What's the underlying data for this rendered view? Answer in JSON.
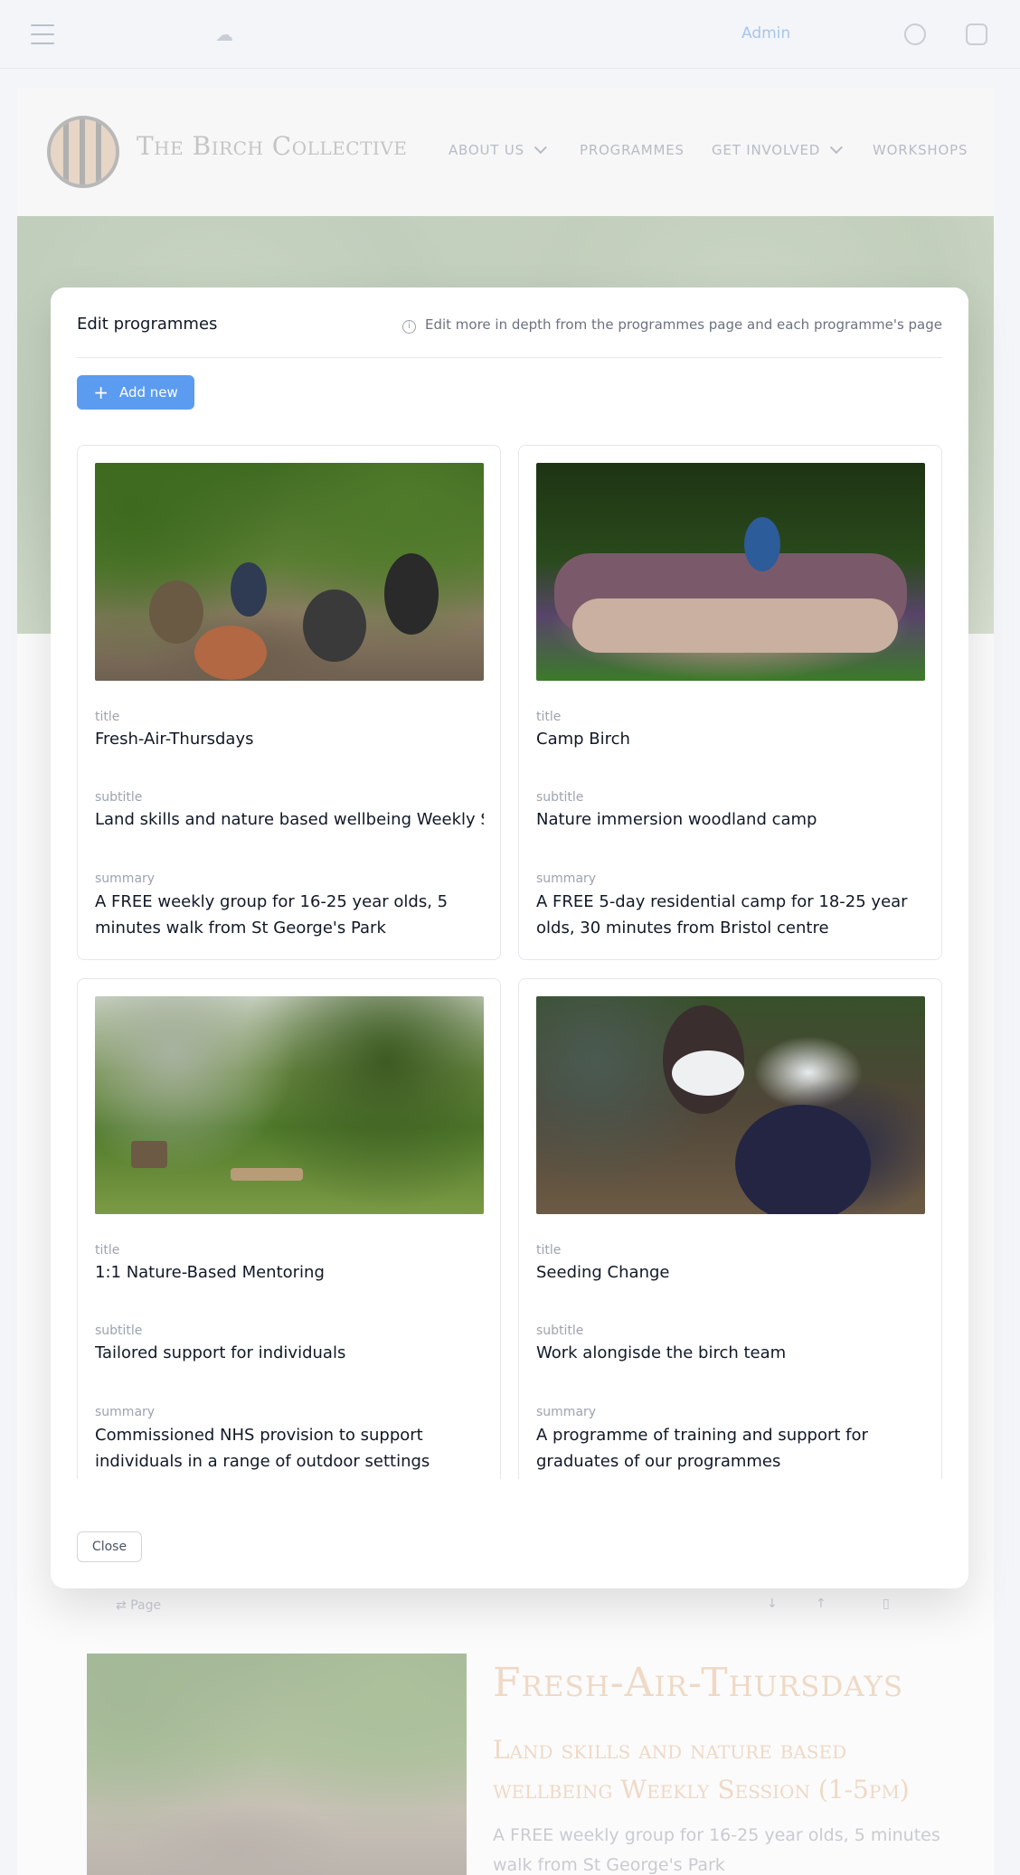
{
  "topbar": {
    "admin_label": "Admin"
  },
  "site": {
    "brand": "The Birch Collective",
    "nav": [
      {
        "label": "ABOUT US",
        "has_dropdown": true
      },
      {
        "label": "PROGRAMMES",
        "has_dropdown": false
      },
      {
        "label": "GET INVOLVED",
        "has_dropdown": true
      },
      {
        "label": "WORKSHOPS",
        "has_dropdown": false
      }
    ]
  },
  "modal": {
    "title": "Edit programmes",
    "hint": "Edit more in depth from the programmes page and each programme's page",
    "add_button": "Add new",
    "close_button": "Close",
    "field_labels": {
      "title": "title",
      "subtitle": "subtitle",
      "summary": "summary"
    },
    "programmes": [
      {
        "title": "Fresh-Air-Thursdays",
        "subtitle": "Land skills and nature based wellbeing Weekly Session (1-5pm)",
        "summary": "A FREE weekly group for 16-25 year olds, 5 minutes walk from St George's Park"
      },
      {
        "title": "Camp Birch",
        "subtitle": "Nature immersion woodland camp",
        "summary": "A FREE 5-day residential camp for 18-25 year olds, 30 minutes from Bristol centre"
      },
      {
        "title": "1:1 Nature-Based Mentoring",
        "subtitle": "Tailored support for individuals",
        "summary": "Commissioned NHS provision to support individuals in a range of outdoor settings"
      },
      {
        "title": "Seeding Change",
        "subtitle": "Work alongisde the birch team",
        "summary": "A programme of training and support for graduates of our programmes"
      }
    ]
  },
  "page_toolbar": {
    "page_label": "Page"
  },
  "background_programme": {
    "title": "Fresh-Air-Thursdays",
    "subtitle": "Land skills and nature based wellbeing Weekly Session (1-5pm)",
    "summary": "A FREE weekly group for 16-25 year olds, 5 minutes walk from St George's Park"
  }
}
